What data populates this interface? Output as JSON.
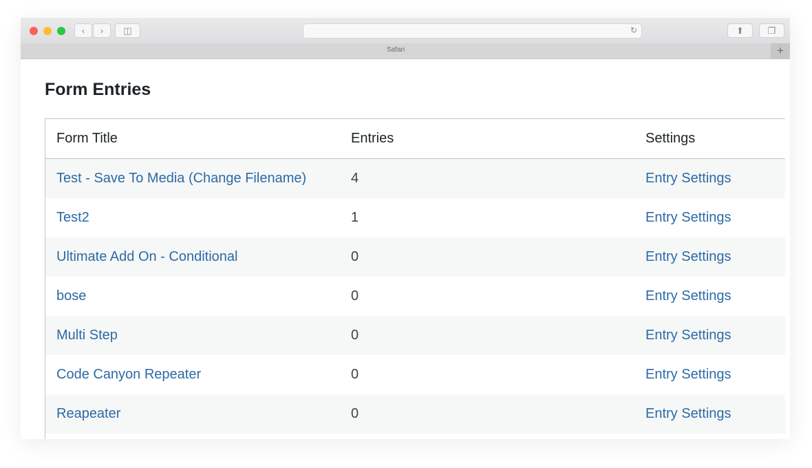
{
  "browser": {
    "tab_title": "Safari",
    "address_value": "",
    "icons": {
      "back": "chevron-left-icon",
      "forward": "chevron-right-icon",
      "sidebar": "sidebar-icon",
      "reload": "reload-icon",
      "share": "share-icon",
      "tabs": "tabs-overview-icon",
      "new_tab": "plus-icon"
    }
  },
  "page": {
    "title": "Form Entries",
    "table": {
      "headers": [
        "Form Title",
        "Entries",
        "Settings"
      ],
      "rows": [
        {
          "title": "Test - Save To Media (Change Filename)",
          "entries": "4",
          "settings": "Entry Settings"
        },
        {
          "title": "Test2",
          "entries": "1",
          "settings": "Entry Settings"
        },
        {
          "title": "Ultimate Add On - Conditional",
          "entries": "0",
          "settings": "Entry Settings"
        },
        {
          "title": "bose",
          "entries": "0",
          "settings": "Entry Settings"
        },
        {
          "title": "Multi Step",
          "entries": "0",
          "settings": "Entry Settings"
        },
        {
          "title": "Code Canyon Repeater",
          "entries": "0",
          "settings": "Entry Settings"
        },
        {
          "title": "Reapeater",
          "entries": "0",
          "settings": "Entry Settings"
        }
      ]
    }
  },
  "colors": {
    "link": "#2c6aa6",
    "text": "#1d2327",
    "alt_row": "#f6f7f7"
  }
}
